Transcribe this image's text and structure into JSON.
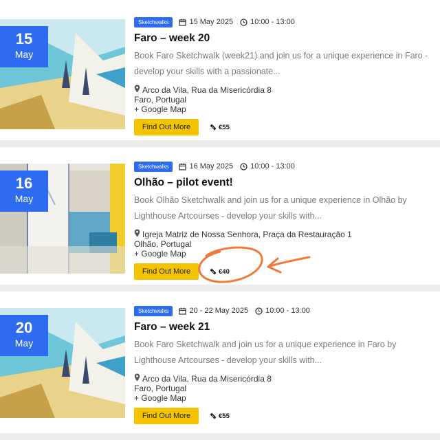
{
  "events": [
    {
      "day": "15",
      "month": "May",
      "tag": "Sketchwalks",
      "date": "15 May 2025",
      "time": "10:00 - 13:00",
      "title": "Faro – week 20",
      "desc1": "Book Faro Sketchwalk (week21) and join us for a unique experience in Faro -",
      "desc2": "develop your skills with a passionate...",
      "address": "Arco da Vila, Rua da Misericórdia 8",
      "city": "Faro, Portugal",
      "map": "+ Google Map",
      "cta": "Find Out More",
      "price": "€55"
    },
    {
      "day": "16",
      "month": "May",
      "tag": "Sketchwalks",
      "date": "16 May 2025",
      "time": "10:00 - 13:00",
      "title": "Olhão – pilot event!",
      "desc1": "Book Olhão Sketchwalk and join us for a unique experience in Olhão by",
      "desc2": "Lighthouse Artcourses - develop your skills with...",
      "address": "Igreja Matriz de Nossa Senhora, Praça da Restauração 1",
      "city": "Olhão, Portugal",
      "map": "+ Google Map",
      "cta": "Find Out More",
      "price": "€40"
    },
    {
      "day": "20",
      "month": "May",
      "tag": "Sketchwalks",
      "date": "20 - 22 May 2025",
      "time": "10:00 - 13:00",
      "title": "Faro – week 21",
      "desc1": "Book Faro Sketchwalk and join us for a unique experience in Faro by",
      "desc2": "Lighthouse Artcourses - develop your skills with...",
      "address": "Arco da Vila, Rua da Misericórdia 8",
      "city": "Faro, Portugal",
      "map": "+ Google Map",
      "cta": "Find Out More",
      "price": "€55"
    }
  ],
  "colors": {
    "accent": "#2d6cf0",
    "button": "#f5c400",
    "annotation": "#f07a3a"
  },
  "icons": {
    "calendar": "calendar-icon",
    "clock": "clock-icon",
    "pin": "map-pin-icon",
    "ticket": "ticket-icon"
  }
}
